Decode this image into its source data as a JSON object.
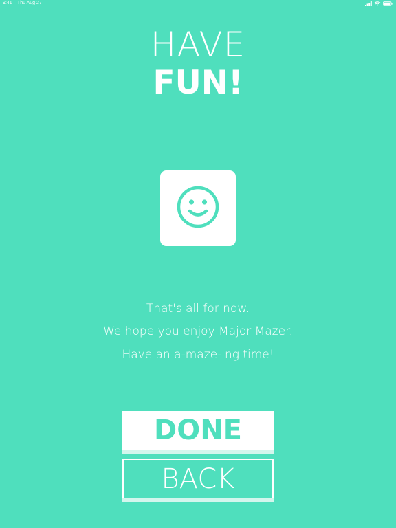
{
  "status_bar": {
    "time": "9:41",
    "date": "Thu Aug 27",
    "icons": [
      "signal-icon",
      "wifi-icon",
      "battery-icon"
    ]
  },
  "title": {
    "line1": "HAVE",
    "line2": "FUN!"
  },
  "smiley": {
    "icon": "smiley-face-icon",
    "color": "#4fdfbd"
  },
  "message": {
    "line1": "That's all for now.",
    "line2": "We hope you enjoy Major Mazer.",
    "line3": "Have an a-maze-ing time!"
  },
  "buttons": {
    "done_label": "DONE",
    "back_label": "BACK"
  },
  "colors": {
    "background": "#4fdfbd",
    "foreground": "#ffffff",
    "button_shadow": "#d3f6ed"
  }
}
